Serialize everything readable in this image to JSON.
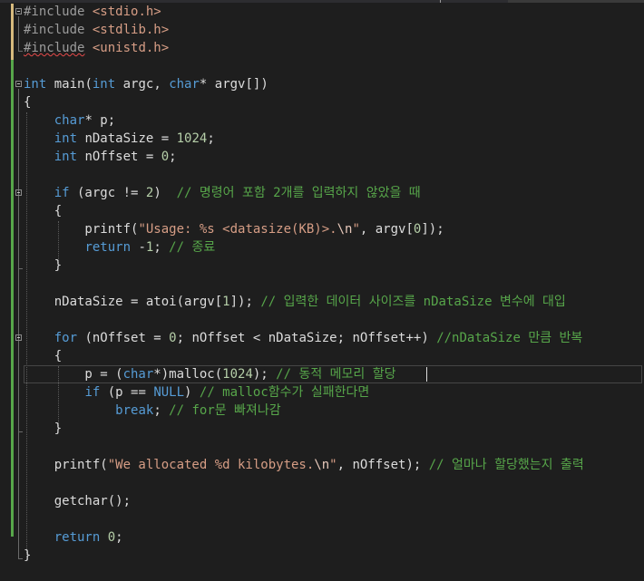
{
  "editor": {
    "lines": [
      {
        "tokens": [
          {
            "t": "#include",
            "c": "pp"
          },
          {
            "t": " ",
            "c": "txt"
          },
          {
            "t": "<stdio.h>",
            "c": "inc"
          }
        ]
      },
      {
        "tokens": [
          {
            "t": "#include",
            "c": "pp"
          },
          {
            "t": " ",
            "c": "txt"
          },
          {
            "t": "<stdlib.h>",
            "c": "inc"
          }
        ]
      },
      {
        "tokens": [
          {
            "t": "#include",
            "c": "pp squig"
          },
          {
            "t": " ",
            "c": "txt"
          },
          {
            "t": "<unistd.h>",
            "c": "inc"
          }
        ]
      },
      {
        "tokens": []
      },
      {
        "tokens": [
          {
            "t": "int",
            "c": "kw"
          },
          {
            "t": " main(",
            "c": "txt"
          },
          {
            "t": "int",
            "c": "kw"
          },
          {
            "t": " argc, ",
            "c": "txt"
          },
          {
            "t": "char",
            "c": "kw"
          },
          {
            "t": "* argv[])",
            "c": "txt"
          }
        ]
      },
      {
        "tokens": [
          {
            "t": "{",
            "c": "txt"
          }
        ]
      },
      {
        "tokens": [
          {
            "t": "    ",
            "c": "txt"
          },
          {
            "t": "char",
            "c": "kw"
          },
          {
            "t": "* p;",
            "c": "txt"
          }
        ]
      },
      {
        "tokens": [
          {
            "t": "    ",
            "c": "txt"
          },
          {
            "t": "int",
            "c": "kw"
          },
          {
            "t": " nDataSize = ",
            "c": "txt"
          },
          {
            "t": "1024",
            "c": "num"
          },
          {
            "t": ";",
            "c": "txt"
          }
        ]
      },
      {
        "tokens": [
          {
            "t": "    ",
            "c": "txt"
          },
          {
            "t": "int",
            "c": "kw"
          },
          {
            "t": " nOffset = ",
            "c": "txt"
          },
          {
            "t": "0",
            "c": "num"
          },
          {
            "t": ";",
            "c": "txt"
          }
        ]
      },
      {
        "tokens": []
      },
      {
        "tokens": [
          {
            "t": "    ",
            "c": "txt"
          },
          {
            "t": "if",
            "c": "kw"
          },
          {
            "t": " (argc != ",
            "c": "txt"
          },
          {
            "t": "2",
            "c": "num"
          },
          {
            "t": ")  ",
            "c": "txt"
          },
          {
            "t": "// 명령어 포함 2개를 입력하지 않았을 때",
            "c": "com"
          }
        ]
      },
      {
        "tokens": [
          {
            "t": "    {",
            "c": "txt"
          }
        ]
      },
      {
        "tokens": [
          {
            "t": "        printf(",
            "c": "txt"
          },
          {
            "t": "\"Usage: %s <datasize(KB)>.",
            "c": "str"
          },
          {
            "t": "\\n",
            "c": "esc"
          },
          {
            "t": "\"",
            "c": "str"
          },
          {
            "t": ", argv[",
            "c": "txt"
          },
          {
            "t": "0",
            "c": "num"
          },
          {
            "t": "]);",
            "c": "txt"
          }
        ]
      },
      {
        "tokens": [
          {
            "t": "        ",
            "c": "txt"
          },
          {
            "t": "return",
            "c": "kw"
          },
          {
            "t": " -",
            "c": "txt"
          },
          {
            "t": "1",
            "c": "num"
          },
          {
            "t": "; ",
            "c": "txt"
          },
          {
            "t": "// 종료",
            "c": "com"
          }
        ]
      },
      {
        "tokens": [
          {
            "t": "    }",
            "c": "txt"
          }
        ]
      },
      {
        "tokens": []
      },
      {
        "tokens": [
          {
            "t": "    nDataSize = atoi(argv[",
            "c": "txt"
          },
          {
            "t": "1",
            "c": "num"
          },
          {
            "t": "]); ",
            "c": "txt"
          },
          {
            "t": "// 입력한 데이터 사이즈를 nDataSize 변수에 대입",
            "c": "com"
          }
        ]
      },
      {
        "tokens": []
      },
      {
        "tokens": [
          {
            "t": "    ",
            "c": "txt"
          },
          {
            "t": "for",
            "c": "kw"
          },
          {
            "t": " (nOffset = ",
            "c": "txt"
          },
          {
            "t": "0",
            "c": "num"
          },
          {
            "t": "; nOffset < nDataSize; nOffset++) ",
            "c": "txt"
          },
          {
            "t": "//nDataSize 만큼 반복",
            "c": "com"
          }
        ]
      },
      {
        "tokens": [
          {
            "t": "    {",
            "c": "txt"
          }
        ]
      },
      {
        "tokens": [
          {
            "t": "        p = (",
            "c": "txt"
          },
          {
            "t": "char",
            "c": "kw"
          },
          {
            "t": "*)malloc(",
            "c": "txt"
          },
          {
            "t": "1024",
            "c": "num"
          },
          {
            "t": "); ",
            "c": "txt"
          },
          {
            "t": "// 동적 메모리 할당",
            "c": "com"
          }
        ]
      },
      {
        "tokens": [
          {
            "t": "        ",
            "c": "txt"
          },
          {
            "t": "if",
            "c": "kw"
          },
          {
            "t": " (p == ",
            "c": "txt"
          },
          {
            "t": "NULL",
            "c": "kw"
          },
          {
            "t": ") ",
            "c": "txt"
          },
          {
            "t": "// malloc함수가 실패한다면",
            "c": "com"
          }
        ]
      },
      {
        "tokens": [
          {
            "t": "            ",
            "c": "txt"
          },
          {
            "t": "break",
            "c": "kw"
          },
          {
            "t": "; ",
            "c": "txt"
          },
          {
            "t": "// for문 빠져나감",
            "c": "com"
          }
        ]
      },
      {
        "tokens": [
          {
            "t": "    }",
            "c": "txt"
          }
        ]
      },
      {
        "tokens": []
      },
      {
        "tokens": [
          {
            "t": "    printf(",
            "c": "txt"
          },
          {
            "t": "\"We allocated %d kilobytes.",
            "c": "str"
          },
          {
            "t": "\\n",
            "c": "esc"
          },
          {
            "t": "\"",
            "c": "str"
          },
          {
            "t": ", nOffset); ",
            "c": "txt"
          },
          {
            "t": "// 얼마나 할당했는지 출력",
            "c": "com"
          }
        ]
      },
      {
        "tokens": []
      },
      {
        "tokens": [
          {
            "t": "    getchar();",
            "c": "txt"
          }
        ]
      },
      {
        "tokens": []
      },
      {
        "tokens": [
          {
            "t": "    ",
            "c": "txt"
          },
          {
            "t": "return",
            "c": "kw"
          },
          {
            "t": " ",
            "c": "txt"
          },
          {
            "t": "0",
            "c": "num"
          },
          {
            "t": ";",
            "c": "txt"
          }
        ]
      },
      {
        "tokens": [
          {
            "t": "}",
            "c": "txt"
          }
        ]
      }
    ],
    "current_line_index": 20,
    "fold_marker_lines": [
      0,
      4,
      10,
      18
    ],
    "colors": {
      "background": "#1e1e1e",
      "keyword": "#569cd6",
      "comment": "#57a64a",
      "string": "#d69d85",
      "number": "#b5cea8",
      "text": "#dcdcdc",
      "preprocessor": "#9b9b9b",
      "change_bar": "#57a64a"
    }
  }
}
